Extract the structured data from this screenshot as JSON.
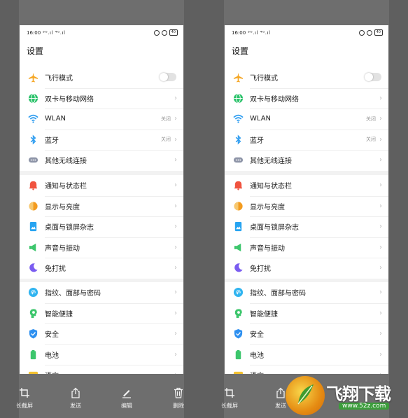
{
  "screens": [
    {
      "status": {
        "time": "16:00",
        "signal": "⁵ᴳ.ıl ⁴ᴳ.ıl",
        "battery": "40"
      },
      "title": "设置",
      "groups": [
        [
          {
            "label": "飞行模式",
            "icon": "airplane-icon",
            "toggle": "off"
          },
          {
            "label": "双卡与移动网络",
            "icon": "globe-icon"
          },
          {
            "label": "WLAN",
            "icon": "wifi-icon",
            "value": "关闭"
          },
          {
            "label": "蓝牙",
            "icon": "bluetooth-icon",
            "value": "关闭"
          },
          {
            "label": "其他无线连接",
            "icon": "more-dots-icon"
          }
        ],
        [
          {
            "label": "通知与状态栏",
            "icon": "bell-icon"
          },
          {
            "label": "显示与亮度",
            "icon": "brightness-icon"
          },
          {
            "label": "桌面与锁屏杂志",
            "icon": "wallpaper-icon"
          },
          {
            "label": "声音与振动",
            "icon": "speaker-icon"
          },
          {
            "label": "免打扰",
            "icon": "moon-icon"
          }
        ],
        [
          {
            "label": "指纹、面部与密码",
            "icon": "fingerprint-icon"
          },
          {
            "label": "智能便捷",
            "icon": "smart-head-icon"
          },
          {
            "label": "安全",
            "icon": "shield-icon"
          },
          {
            "label": "电池",
            "icon": "battery-icon"
          },
          {
            "label": "语言",
            "icon": "language-icon"
          }
        ]
      ]
    },
    {
      "status": {
        "time": "16:00",
        "signal": "⁵ᴳ.ıl ⁴ᴳ.ıl",
        "battery": "40"
      },
      "title": "设置",
      "groups": [
        [
          {
            "label": "飞行模式",
            "icon": "airplane-icon",
            "toggle": "off"
          },
          {
            "label": "双卡与移动网络",
            "icon": "globe-icon"
          },
          {
            "label": "WLAN",
            "icon": "wifi-icon",
            "value": "关闭"
          },
          {
            "label": "蓝牙",
            "icon": "bluetooth-icon",
            "value": "关闭"
          },
          {
            "label": "其他无线连接",
            "icon": "more-dots-icon"
          }
        ],
        [
          {
            "label": "通知与状态栏",
            "icon": "bell-icon"
          },
          {
            "label": "显示与亮度",
            "icon": "brightness-icon"
          },
          {
            "label": "桌面与锁屏杂志",
            "icon": "wallpaper-icon"
          },
          {
            "label": "声音与振动",
            "icon": "speaker-icon"
          },
          {
            "label": "免打扰",
            "icon": "moon-icon"
          }
        ],
        [
          {
            "label": "指纹、面部与密码",
            "icon": "fingerprint-icon"
          },
          {
            "label": "智能便捷",
            "icon": "smart-head-icon"
          },
          {
            "label": "安全",
            "icon": "shield-icon"
          },
          {
            "label": "电池",
            "icon": "battery-icon"
          },
          {
            "label": "语言",
            "icon": "language-icon"
          }
        ]
      ]
    }
  ],
  "toolbar": {
    "left": [
      {
        "label": "长截屏",
        "icon": "crop-icon"
      },
      {
        "label": "发送",
        "icon": "share-icon"
      },
      {
        "label": "编辑",
        "icon": "pen-icon"
      },
      {
        "label": "删除",
        "icon": "trash-icon"
      }
    ],
    "right": [
      {
        "label": "长截屏",
        "icon": "crop-icon"
      },
      {
        "label": "发送",
        "icon": "share-icon"
      }
    ]
  },
  "watermark": {
    "brand": "飞翔下载",
    "url": "www.52z.com"
  },
  "colors": {
    "airplane": "#f5a623",
    "globe": "#2cc36b",
    "wifi": "#2d9cf0",
    "bluetooth": "#2d9cf0",
    "more": "#8e95a8",
    "bell": "#f0533f",
    "brightness": "#f39b1f",
    "wallpaper": "#27a4f1",
    "speaker": "#3cc66c",
    "moon": "#7a5cf0",
    "fingerprint": "#30b4f0",
    "smart": "#3cc66c",
    "shield": "#2e90f0",
    "battery": "#3cc66c",
    "language": "#f5c231"
  }
}
